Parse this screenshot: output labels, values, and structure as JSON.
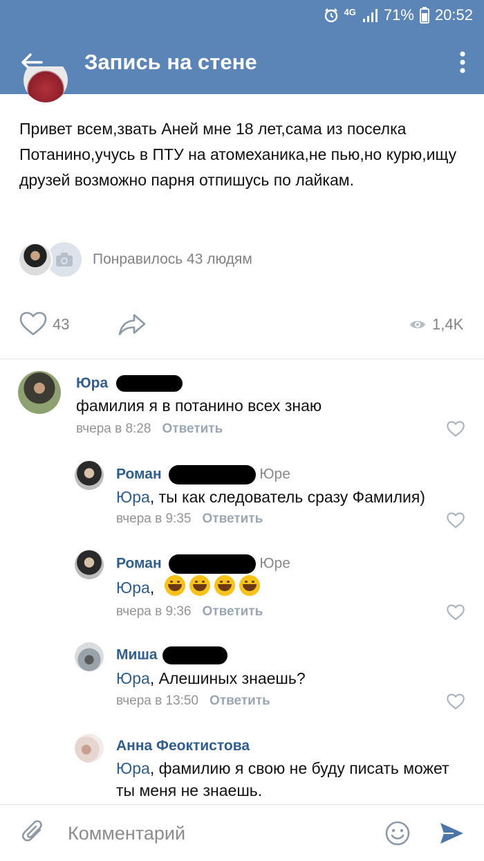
{
  "status_bar": {
    "network": "4G",
    "battery": "71%",
    "time": "20:52"
  },
  "app_bar": {
    "title": "Запись на стене"
  },
  "post": {
    "text": "Привет всем,звать Аней мне 18 лет,сама из поселка Потанино,учусь в ПТУ на атомеханика,не пью,но курю,ищу друзей возможно парня отпишусь по лайкам.",
    "likes_text": "Понравилось 43 людям",
    "like_count": "43",
    "views": "1,4K"
  },
  "comments": [
    {
      "author": "Юра",
      "text": "фамилия я в потанино всех знаю",
      "time": "вчера в 8:28",
      "reply_label": "Ответить"
    },
    {
      "author": "Роман",
      "reply_to": "Юре",
      "mention": "Юра",
      "text": ", ты как следователь сразу Фамилия)",
      "time": "вчера в 9:35",
      "reply_label": "Ответить"
    },
    {
      "author": "Роман",
      "reply_to": "Юре",
      "mention": "Юра",
      "text": ",",
      "emoji": [
        "grinning-face",
        "grinning-face",
        "grinning-face",
        "grinning-face"
      ],
      "time": "вчера в 9:36",
      "reply_label": "Ответить"
    },
    {
      "author": "Миша",
      "mention": "Юра",
      "text": ", Алешиных знаешь?",
      "time": "вчера в 13:50",
      "reply_label": "Ответить"
    },
    {
      "author": "Анна Феоктистова",
      "mention": "Юра",
      "text": ", фамилию я свою не буду писать может ты меня не знаешь."
    }
  ],
  "composer": {
    "placeholder": "Комментарий"
  },
  "colors": {
    "header": "#5b84b7",
    "link": "#2f5d8c",
    "muted": "#939393",
    "send": "#4a76a8"
  }
}
